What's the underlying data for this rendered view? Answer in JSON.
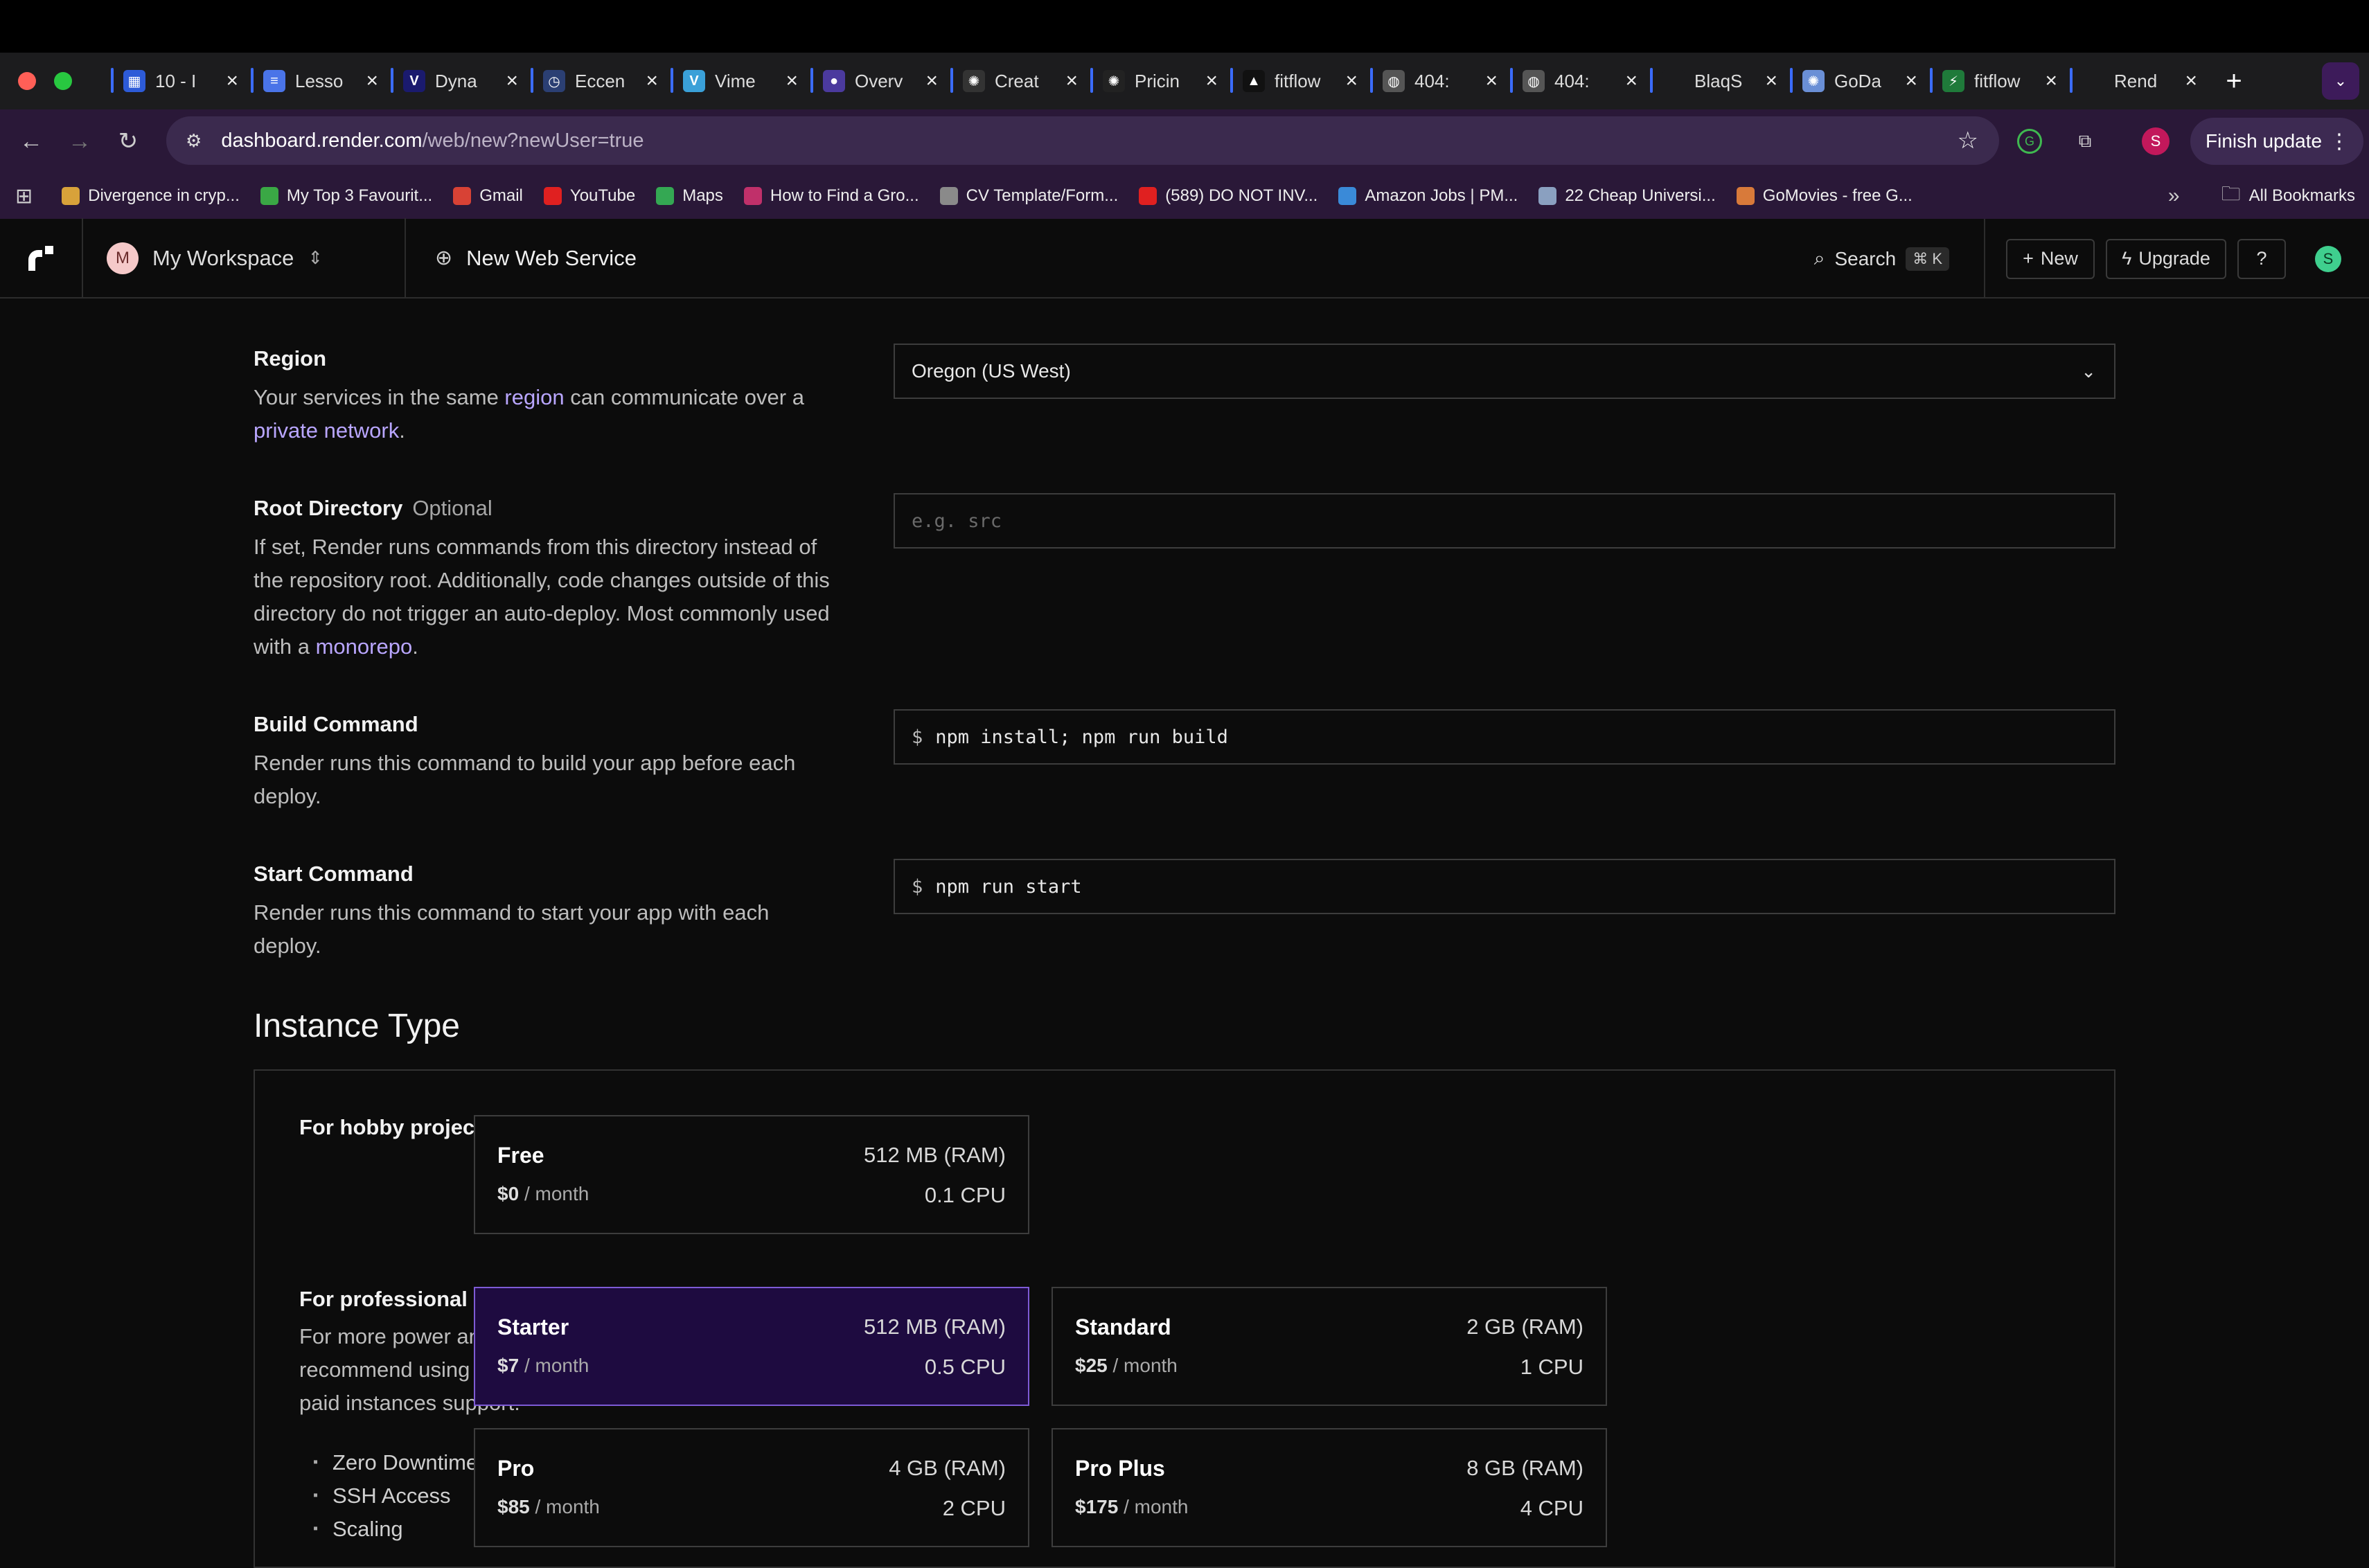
{
  "browser": {
    "tabs": [
      {
        "title": "10 - I",
        "icon": "list-icon",
        "color": "#2d5bd8",
        "glyph": "▦"
      },
      {
        "title": "Lesso",
        "icon": "doc-icon",
        "color": "#4a74e8",
        "glyph": "≡"
      },
      {
        "title": "Dyna",
        "icon": "v-icon",
        "color": "#1a1a6e",
        "glyph": "V"
      },
      {
        "title": "Eccen",
        "icon": "clock-icon",
        "color": "#2b3f73",
        "glyph": "◷"
      },
      {
        "title": "Vime",
        "icon": "v-circle-icon",
        "color": "#3aa0d8",
        "glyph": "V"
      },
      {
        "title": "Overv",
        "icon": "circle-icon",
        "color": "#4b3a9e",
        "glyph": "●"
      },
      {
        "title": "Creat",
        "icon": "openai-icon",
        "color": "#333333",
        "glyph": "✺"
      },
      {
        "title": "Pricin",
        "icon": "openai-icon",
        "color": "#222222",
        "glyph": "✺"
      },
      {
        "title": "fitflow",
        "icon": "a-icon",
        "color": "#111111",
        "glyph": "▲"
      },
      {
        "title": "404:",
        "icon": "globe-icon",
        "color": "#555555",
        "glyph": "◍"
      },
      {
        "title": "404:",
        "icon": "globe-icon",
        "color": "#555555",
        "glyph": "◍"
      },
      {
        "title": "BlaqS",
        "icon": "blank-icon",
        "color": "#1c1c1e",
        "glyph": ""
      },
      {
        "title": "GoDa",
        "icon": "openai-icon",
        "color": "#6a8fd6",
        "glyph": "✺"
      },
      {
        "title": "fitflow",
        "icon": "bolt-icon",
        "color": "#1f7a3a",
        "glyph": "⚡"
      },
      {
        "title": "Rend",
        "icon": "blank-icon",
        "color": "#1c1c1e",
        "glyph": ""
      }
    ],
    "url_host": "dashboard.render.com",
    "url_path": "/web/new?newUser=true",
    "profile_initial": "S",
    "finish_update": "Finish update",
    "bookmarks": [
      {
        "label": "Divergence in cryp...",
        "color": "#d8a23a"
      },
      {
        "label": "My Top 3 Favourit...",
        "color": "#3aa845"
      },
      {
        "label": "Gmail",
        "color": "#d84235"
      },
      {
        "label": "YouTube",
        "color": "#e02020"
      },
      {
        "label": "Maps",
        "color": "#34a853"
      },
      {
        "label": "How to Find a Gro...",
        "color": "#c0306a"
      },
      {
        "label": "CV Template/Form...",
        "color": "#8a8a8a"
      },
      {
        "label": "(589) DO NOT INV...",
        "color": "#e02020"
      },
      {
        "label": "Amazon Jobs | PM...",
        "color": "#3a8ad8"
      },
      {
        "label": "22 Cheap Universi...",
        "color": "#8aa0c0"
      },
      {
        "label": "GoMovies - free G...",
        "color": "#d87a3a"
      }
    ],
    "all_bookmarks": "All Bookmarks"
  },
  "app": {
    "workspace_initial": "M",
    "workspace": "My Workspace",
    "page_title": "New Web Service",
    "search": "Search",
    "search_kbd": "⌘ K",
    "new_label": "New",
    "upgrade_label": "Upgrade",
    "user_initial": "S"
  },
  "form": {
    "region": {
      "label": "Region",
      "desc_pre": "Your services in the same ",
      "desc_link1": "region",
      "desc_mid": " can communicate over a ",
      "desc_link2": "private network",
      "desc_post": ".",
      "value": "Oregon (US West)"
    },
    "root_dir": {
      "label": "Root Directory",
      "optional": "Optional",
      "desc_pre": "If set, Render runs commands from this directory instead of the repository root. Additionally, code changes outside of this directory do not trigger an auto-deploy. Most commonly used with a ",
      "desc_link": "monorepo",
      "desc_post": ".",
      "placeholder": "e.g. src"
    },
    "build": {
      "label": "Build Command",
      "desc": "Render runs this command to build your app before each deploy.",
      "prefix": "$",
      "value": "npm install; npm run build"
    },
    "start": {
      "label": "Start Command",
      "desc": "Render runs this command to start your app with each deploy.",
      "prefix": "$",
      "value": "npm run start"
    }
  },
  "instance": {
    "heading": "Instance Type",
    "hobby_label": "For hobby projects",
    "pro_label": "For professional use",
    "pro_desc": "For more power and to get the most out of Render, we recommend using one of our paid instance types. All paid instances support:",
    "features": [
      "Zero Downtime",
      "SSH Access",
      "Scaling"
    ],
    "plans": [
      {
        "name": "Free",
        "ram": "512 MB (RAM)",
        "price": "$0",
        "period": "/ month",
        "cpu": "0.1 CPU",
        "selected": false
      },
      {
        "name": "Starter",
        "ram": "512 MB (RAM)",
        "price": "$7",
        "period": "/ month",
        "cpu": "0.5 CPU",
        "selected": true
      },
      {
        "name": "Standard",
        "ram": "2 GB (RAM)",
        "price": "$25",
        "period": "/ month",
        "cpu": "1 CPU",
        "selected": false
      },
      {
        "name": "Pro",
        "ram": "4 GB (RAM)",
        "price": "$85",
        "period": "/ month",
        "cpu": "2 CPU",
        "selected": false
      },
      {
        "name": "Pro Plus",
        "ram": "8 GB (RAM)",
        "price": "$175",
        "period": "/ month",
        "cpu": "4 CPU",
        "selected": false
      }
    ]
  }
}
